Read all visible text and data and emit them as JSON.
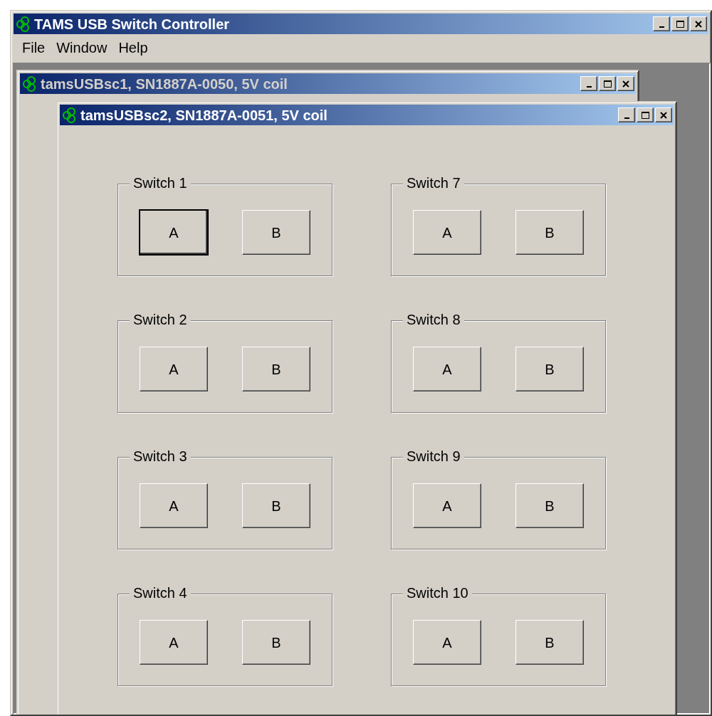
{
  "window": {
    "title": "TAMS USB Switch Controller"
  },
  "menu": [
    "File",
    "Window",
    "Help"
  ],
  "child_windows": [
    {
      "title": "tamsUSBsc1, SN1887A-0050, 5V coil",
      "active": false
    },
    {
      "title": "tamsUSBsc2, SN1887A-0051, 5V coil",
      "active": true,
      "switches": [
        {
          "label": "Switch 1",
          "buttons": [
            {
              "label": "A",
              "default": true
            },
            {
              "label": "B",
              "default": false
            }
          ]
        },
        {
          "label": "Switch 7",
          "buttons": [
            {
              "label": "A",
              "default": false
            },
            {
              "label": "B",
              "default": false
            }
          ]
        },
        {
          "label": "Switch 2",
          "buttons": [
            {
              "label": "A",
              "default": false
            },
            {
              "label": "B",
              "default": false
            }
          ]
        },
        {
          "label": "Switch 8",
          "buttons": [
            {
              "label": "A",
              "default": false
            },
            {
              "label": "B",
              "default": false
            }
          ]
        },
        {
          "label": "Switch 3",
          "buttons": [
            {
              "label": "A",
              "default": false
            },
            {
              "label": "B",
              "default": false
            }
          ]
        },
        {
          "label": "Switch 9",
          "buttons": [
            {
              "label": "A",
              "default": false
            },
            {
              "label": "B",
              "default": false
            }
          ]
        },
        {
          "label": "Switch 4",
          "buttons": [
            {
              "label": "A",
              "default": false
            },
            {
              "label": "B",
              "default": false
            }
          ]
        },
        {
          "label": "Switch 10",
          "buttons": [
            {
              "label": "A",
              "default": false
            },
            {
              "label": "B",
              "default": false
            }
          ]
        }
      ]
    }
  ]
}
